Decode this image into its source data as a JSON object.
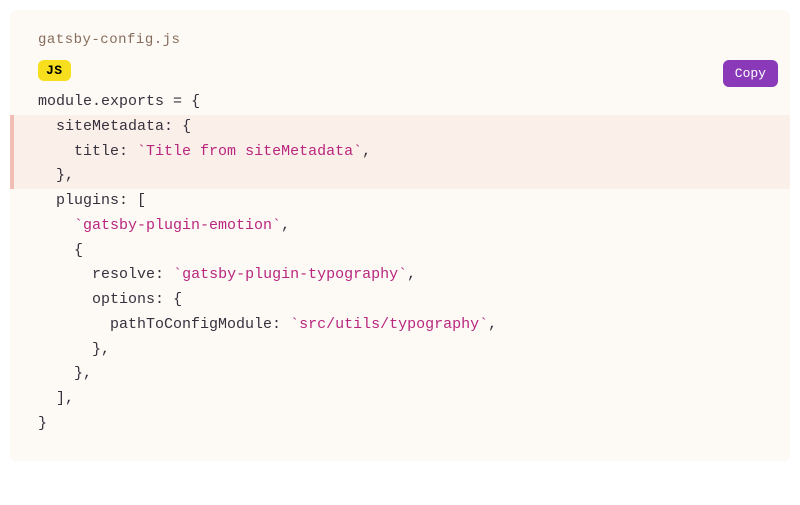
{
  "filename": "gatsby-config.js",
  "language_badge": "JS",
  "copy_button_label": "Copy",
  "code_lines": [
    {
      "highlighted": false,
      "segments": [
        {
          "text": "module",
          "cls": "token-plain"
        },
        {
          "text": ".",
          "cls": "token-punctuation"
        },
        {
          "text": "exports ",
          "cls": "token-plain"
        },
        {
          "text": "=",
          "cls": "token-punctuation"
        },
        {
          "text": " ",
          "cls": "token-plain"
        },
        {
          "text": "{",
          "cls": "token-punctuation"
        }
      ]
    },
    {
      "highlighted": true,
      "segments": [
        {
          "text": "  siteMetadata",
          "cls": "token-property"
        },
        {
          "text": ":",
          "cls": "token-punctuation"
        },
        {
          "text": " ",
          "cls": "token-plain"
        },
        {
          "text": "{",
          "cls": "token-punctuation"
        }
      ]
    },
    {
      "highlighted": true,
      "segments": [
        {
          "text": "    title",
          "cls": "token-property"
        },
        {
          "text": ":",
          "cls": "token-punctuation"
        },
        {
          "text": " ",
          "cls": "token-plain"
        },
        {
          "text": "`Title from siteMetadata`",
          "cls": "token-template-string"
        },
        {
          "text": ",",
          "cls": "token-punctuation"
        }
      ]
    },
    {
      "highlighted": true,
      "segments": [
        {
          "text": "  ",
          "cls": "token-plain"
        },
        {
          "text": "}",
          "cls": "token-punctuation"
        },
        {
          "text": ",",
          "cls": "token-punctuation"
        }
      ]
    },
    {
      "highlighted": false,
      "segments": [
        {
          "text": "  plugins",
          "cls": "token-property"
        },
        {
          "text": ":",
          "cls": "token-punctuation"
        },
        {
          "text": " ",
          "cls": "token-plain"
        },
        {
          "text": "[",
          "cls": "token-punctuation"
        }
      ]
    },
    {
      "highlighted": false,
      "segments": [
        {
          "text": "    ",
          "cls": "token-plain"
        },
        {
          "text": "`gatsby-plugin-emotion`",
          "cls": "token-template-string"
        },
        {
          "text": ",",
          "cls": "token-punctuation"
        }
      ]
    },
    {
      "highlighted": false,
      "segments": [
        {
          "text": "    ",
          "cls": "token-plain"
        },
        {
          "text": "{",
          "cls": "token-punctuation"
        }
      ]
    },
    {
      "highlighted": false,
      "segments": [
        {
          "text": "      resolve",
          "cls": "token-property"
        },
        {
          "text": ":",
          "cls": "token-punctuation"
        },
        {
          "text": " ",
          "cls": "token-plain"
        },
        {
          "text": "`gatsby-plugin-typography`",
          "cls": "token-template-string"
        },
        {
          "text": ",",
          "cls": "token-punctuation"
        }
      ]
    },
    {
      "highlighted": false,
      "segments": [
        {
          "text": "      options",
          "cls": "token-property"
        },
        {
          "text": ":",
          "cls": "token-punctuation"
        },
        {
          "text": " ",
          "cls": "token-plain"
        },
        {
          "text": "{",
          "cls": "token-punctuation"
        }
      ]
    },
    {
      "highlighted": false,
      "segments": [
        {
          "text": "        pathToConfigModule",
          "cls": "token-property"
        },
        {
          "text": ":",
          "cls": "token-punctuation"
        },
        {
          "text": " ",
          "cls": "token-plain"
        },
        {
          "text": "`src/utils/typography`",
          "cls": "token-template-string"
        },
        {
          "text": ",",
          "cls": "token-punctuation"
        }
      ]
    },
    {
      "highlighted": false,
      "segments": [
        {
          "text": "      ",
          "cls": "token-plain"
        },
        {
          "text": "}",
          "cls": "token-punctuation"
        },
        {
          "text": ",",
          "cls": "token-punctuation"
        }
      ]
    },
    {
      "highlighted": false,
      "segments": [
        {
          "text": "    ",
          "cls": "token-plain"
        },
        {
          "text": "}",
          "cls": "token-punctuation"
        },
        {
          "text": ",",
          "cls": "token-punctuation"
        }
      ]
    },
    {
      "highlighted": false,
      "segments": [
        {
          "text": "  ",
          "cls": "token-plain"
        },
        {
          "text": "]",
          "cls": "token-punctuation"
        },
        {
          "text": ",",
          "cls": "token-punctuation"
        }
      ]
    },
    {
      "highlighted": false,
      "segments": [
        {
          "text": "}",
          "cls": "token-punctuation"
        }
      ]
    }
  ]
}
